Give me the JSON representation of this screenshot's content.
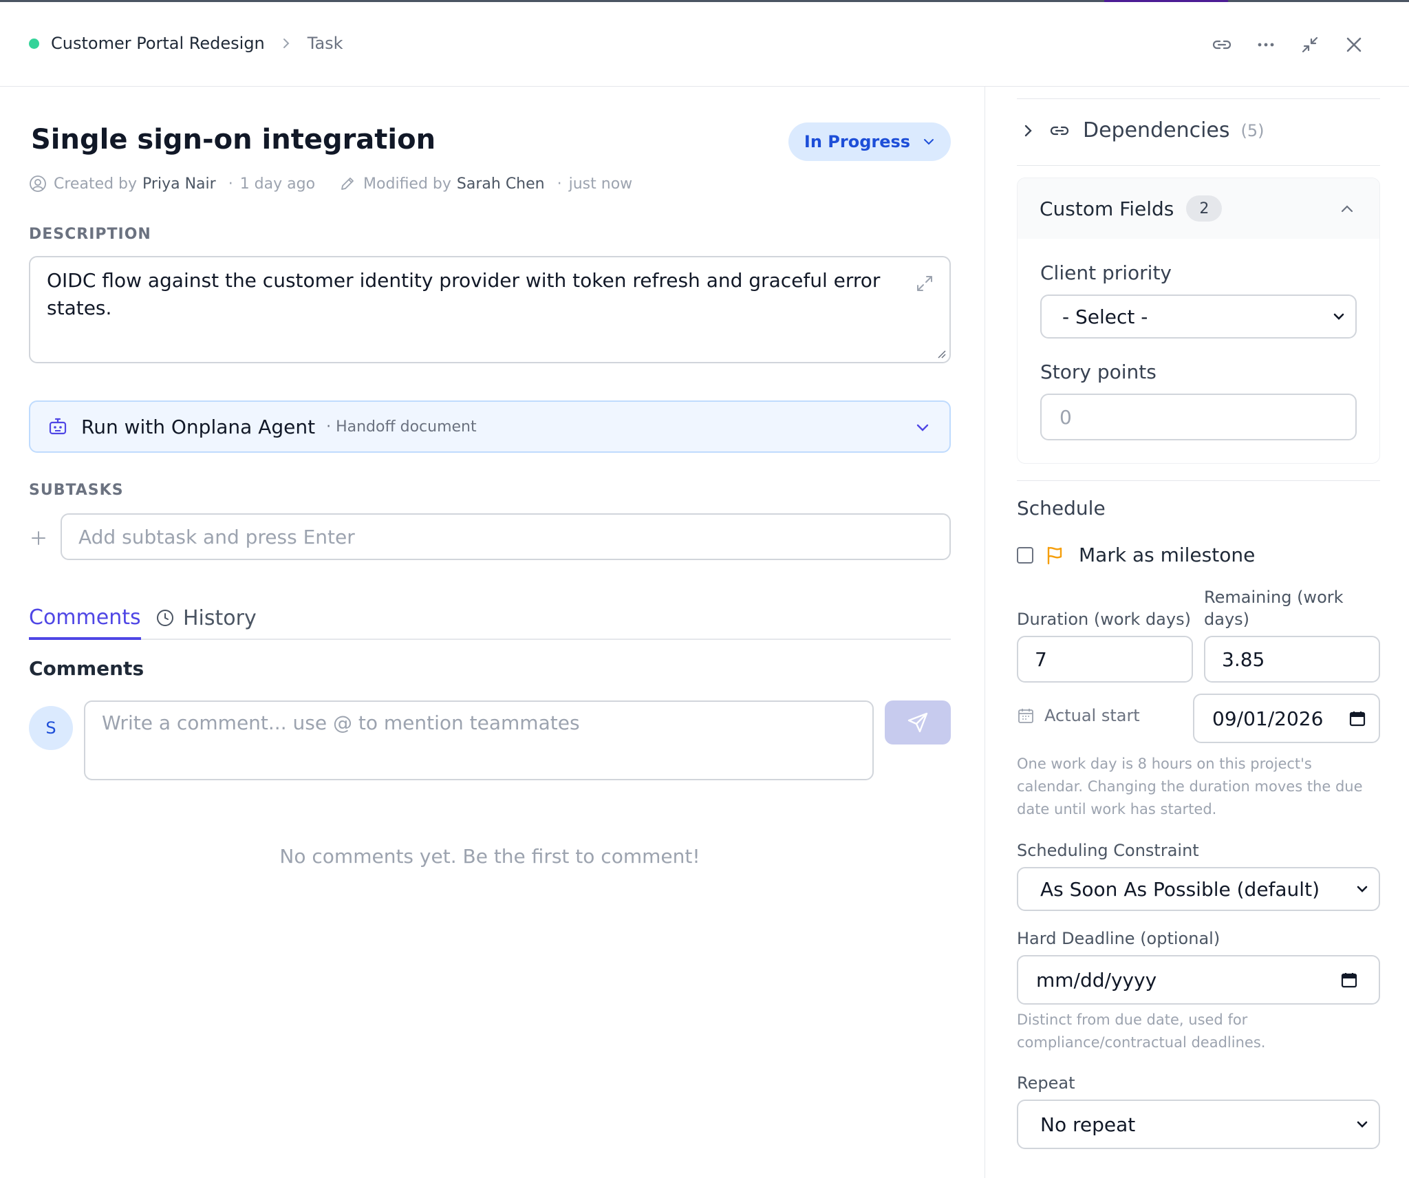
{
  "header": {
    "project": "Customer Portal Redesign",
    "crumb": "Task",
    "icons": [
      "link-icon",
      "more-icon",
      "minimize-icon",
      "close-icon"
    ]
  },
  "task": {
    "title": "Single sign-on integration",
    "status": "In Progress",
    "created_label": "Created by",
    "created_by": "Priya Nair",
    "created_when": "1 day ago",
    "modified_label": "Modified by",
    "modified_by": "Sarah Chen",
    "modified_when": "just now"
  },
  "description": {
    "label": "DESCRIPTION",
    "text": "OIDC flow against the customer identity provider with token refresh and graceful error states."
  },
  "agent": {
    "label": "Run with Onplana Agent",
    "sub": "· Handoff document"
  },
  "subtasks": {
    "label": "SUBTASKS",
    "placeholder": "Add subtask and press Enter"
  },
  "tabs": {
    "comments": "Comments",
    "history": "History"
  },
  "comments": {
    "heading": "Comments",
    "avatar": "S",
    "placeholder": "Write a comment... use @ to mention teammates",
    "empty": "No comments yet. Be the first to comment!"
  },
  "dependencies": {
    "label": "Dependencies",
    "count": "(5)"
  },
  "custom_fields": {
    "label": "Custom Fields",
    "count": "2",
    "client_priority_label": "Client priority",
    "client_priority_value": "- Select -",
    "story_points_label": "Story points",
    "story_points_placeholder": "0"
  },
  "schedule": {
    "heading": "Schedule",
    "milestone_label": "Mark as milestone",
    "duration_label": "Duration (work days)",
    "duration_value": "7",
    "remaining_label_1": "Remaining (work",
    "remaining_label_2": "days)",
    "remaining_value": "3.85",
    "actual_start_label": "Actual start",
    "actual_start_value": "09/01/2026",
    "help_1": "One work day is 8 hours on this project's",
    "help_2": "calendar. Changing the duration moves the due",
    "help_3": "date until work has started.",
    "constraint_label": "Scheduling Constraint",
    "constraint_value": "As Soon As Possible (default)",
    "deadline_label": "Hard Deadline (optional)",
    "deadline_placeholder": "mm/dd/yyyy",
    "deadline_help_1": "Distinct from due date, used for",
    "deadline_help_2": "compliance/contractual deadlines.",
    "repeat_label": "Repeat",
    "repeat_value": "No repeat"
  },
  "colors": {
    "status_bg": "#dbeafe",
    "status_text": "#1d4ed8",
    "accent": "#4f46e5",
    "project_dot": "#34d399",
    "milestone_flag": "#f59e0b"
  }
}
